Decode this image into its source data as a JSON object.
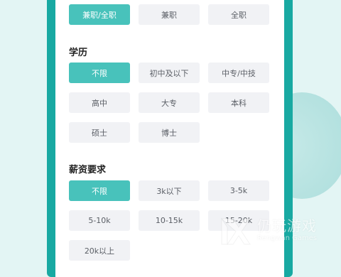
{
  "work_type": {
    "options": [
      "兼职/全职",
      "兼职",
      "全职"
    ],
    "selected": 0
  },
  "education": {
    "title": "学历",
    "options": [
      "不限",
      "初中及以下",
      "中专/中技",
      "高中",
      "大专",
      "本科",
      "硕士",
      "博士"
    ],
    "selected": 0
  },
  "salary": {
    "title": "薪资要求",
    "options": [
      "不限",
      "3k以下",
      "3-5k",
      "5-10k",
      "10-15k",
      "15-20k",
      "20k以上"
    ],
    "selected": 0
  },
  "watermark": {
    "name": "仍玩游戏",
    "sub": "Rengwan Games"
  },
  "colors": {
    "accent": "#48c2bb",
    "frame": "#18a9a2",
    "chip_bg": "#f1f2f5",
    "background": "#e3f5f4"
  }
}
